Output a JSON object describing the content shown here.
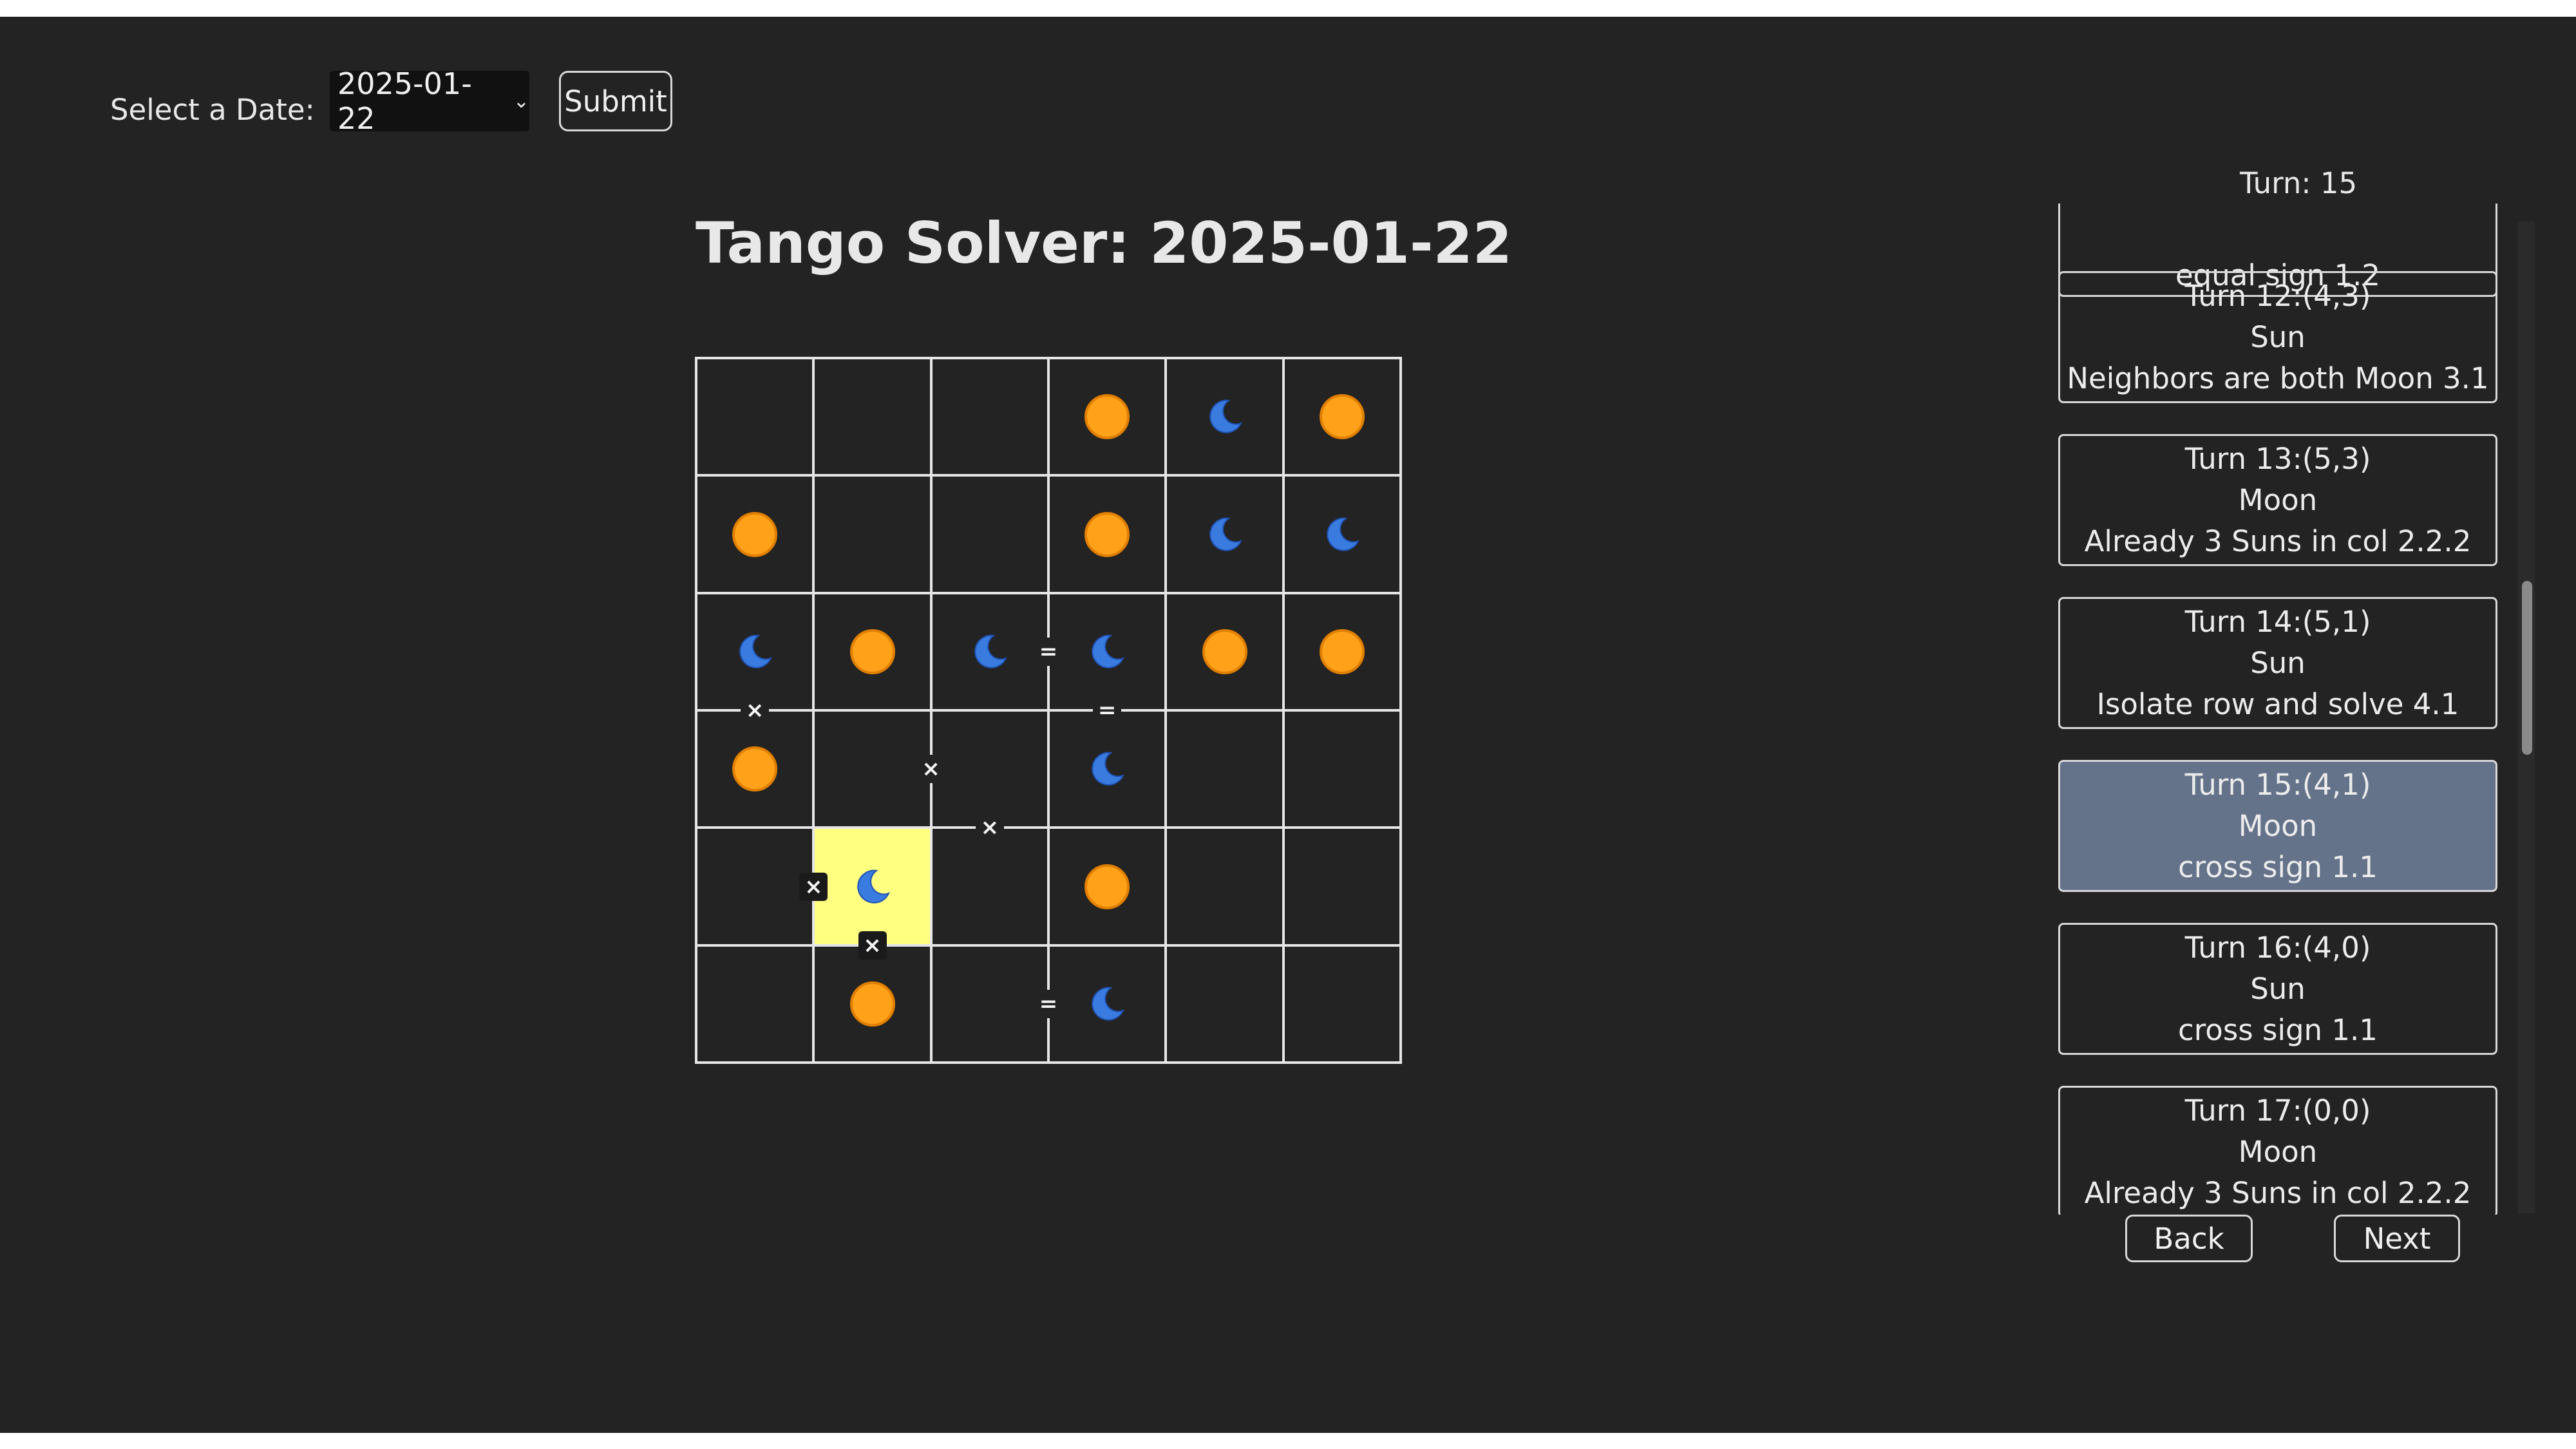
{
  "controls": {
    "date_label": "Select a Date:",
    "date_value": "2025-01-22",
    "submit_label": "Submit"
  },
  "title": "Tango Solver: 2025-01-22",
  "board": {
    "size": 6,
    "cells": [
      [
        "",
        "",
        "",
        "sun",
        "moon",
        "sun"
      ],
      [
        "sun",
        "",
        "",
        "sun",
        "moon",
        "moon"
      ],
      [
        "moon",
        "sun",
        "moon",
        "moon",
        "sun",
        "sun"
      ],
      [
        "sun",
        "",
        "",
        "moon",
        "",
        ""
      ],
      [
        "",
        "moon",
        "",
        "sun",
        "",
        ""
      ],
      [
        "",
        "sun",
        "",
        "moon",
        "",
        ""
      ]
    ],
    "highlighted_cell": {
      "row": 4,
      "col": 1
    },
    "constraints": [
      {
        "type": "equal",
        "cells": [
          [
            2,
            2
          ],
          [
            2,
            3
          ]
        ],
        "symbol": "="
      },
      {
        "type": "cross",
        "cells": [
          [
            2,
            0
          ],
          [
            3,
            0
          ]
        ],
        "symbol": "×"
      },
      {
        "type": "equal",
        "cells": [
          [
            2,
            3
          ],
          [
            3,
            3
          ]
        ],
        "symbol": "="
      },
      {
        "type": "cross",
        "cells": [
          [
            3,
            1
          ],
          [
            3,
            2
          ]
        ],
        "symbol": "×"
      },
      {
        "type": "cross",
        "cells": [
          [
            3,
            2
          ],
          [
            4,
            2
          ]
        ],
        "symbol": "×"
      },
      {
        "type": "cross",
        "cells": [
          [
            4,
            0
          ],
          [
            4,
            1
          ]
        ],
        "symbol": "×"
      },
      {
        "type": "cross",
        "cells": [
          [
            4,
            1
          ],
          [
            5,
            1
          ]
        ],
        "symbol": "×"
      },
      {
        "type": "equal",
        "cells": [
          [
            5,
            2
          ],
          [
            5,
            3
          ]
        ],
        "symbol": "="
      }
    ],
    "colors": {
      "sun": "#ffa21a",
      "moon": "#3a7be0",
      "highlight": "#ffff80",
      "grid": "#e6e6e6"
    }
  },
  "solver": {
    "turn_label": "Turn: 15",
    "partial_reason": "equal sign 1.2",
    "turns": [
      {
        "label": "Turn 12:(4,3)",
        "value": "Sun",
        "reason": "Neighbors are both Moon 3.1"
      },
      {
        "label": "Turn 13:(5,3)",
        "value": "Moon",
        "reason": "Already 3 Suns in col 2.2.2"
      },
      {
        "label": "Turn 14:(5,1)",
        "value": "Sun",
        "reason": "Isolate row and solve 4.1"
      },
      {
        "label": "Turn 15:(4,1)",
        "value": "Moon",
        "reason": "cross sign 1.1",
        "active": true
      },
      {
        "label": "Turn 16:(4,0)",
        "value": "Sun",
        "reason": "cross sign 1.1"
      },
      {
        "label": "Turn 17:(0,0)",
        "value": "Moon",
        "reason": "Already 3 Suns in col 2.2.2"
      }
    ],
    "back_label": "Back",
    "next_label": "Next"
  }
}
